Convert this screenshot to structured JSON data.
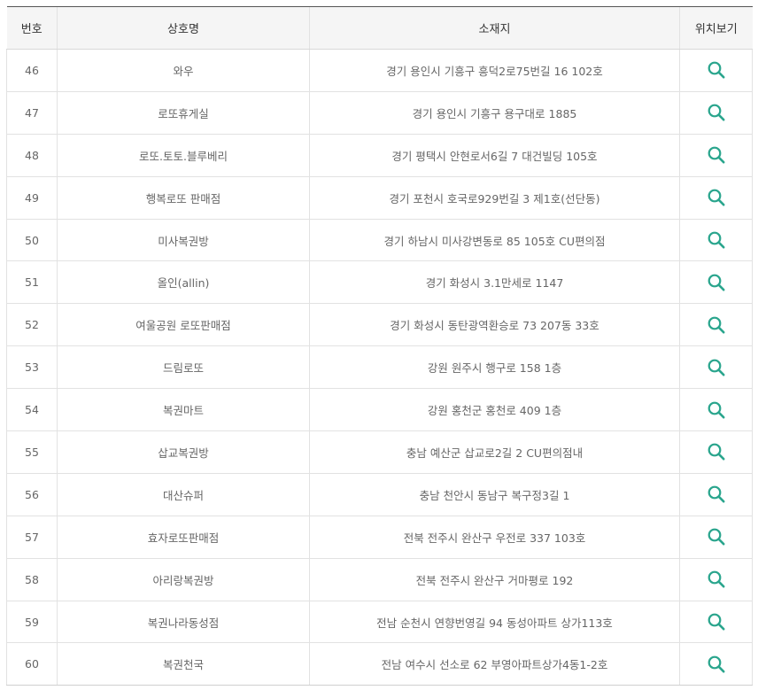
{
  "table": {
    "headers": [
      "번호",
      "상호명",
      "소재지",
      "위치보기"
    ],
    "rows": [
      {
        "no": "46",
        "name": "와우",
        "address": "경기 용인시 기흥구 흥덕2로75번길 16 102호"
      },
      {
        "no": "47",
        "name": "로또휴게실",
        "address": "경기 용인시 기흥구 용구대로 1885"
      },
      {
        "no": "48",
        "name": "로또.토토.블루베리",
        "address": "경기 평택시 안현로서6길 7 대건빌딩 105호"
      },
      {
        "no": "49",
        "name": "행복로또 판매점",
        "address": "경기 포천시 호국로929번길 3 제1호(선단동)"
      },
      {
        "no": "50",
        "name": "미사복권방",
        "address": "경기 하남시 미사강변동로 85 105호 CU편의점"
      },
      {
        "no": "51",
        "name": "올인(allin)",
        "address": "경기 화성시 3.1만세로 1147"
      },
      {
        "no": "52",
        "name": "여울공원 로또판매점",
        "address": "경기 화성시 동탄광역환승로 73 207동 33호"
      },
      {
        "no": "53",
        "name": "드림로또",
        "address": "강원 원주시 행구로 158 1층"
      },
      {
        "no": "54",
        "name": "복권마트",
        "address": "강원 홍천군 홍천로 409 1층"
      },
      {
        "no": "55",
        "name": "삽교복권방",
        "address": "충남 예산군 삽교로2길 2 CU편의점내"
      },
      {
        "no": "56",
        "name": "대산슈퍼",
        "address": "충남 천안시 동남구 복구정3길 1"
      },
      {
        "no": "57",
        "name": "효자로또판매점",
        "address": "전북 전주시 완산구 우전로 337 103호"
      },
      {
        "no": "58",
        "name": "아리랑복권방",
        "address": "전북 전주시 완산구 거마평로 192"
      },
      {
        "no": "59",
        "name": "복권나라동성점",
        "address": "전남 순천시 연향번영길 94 동성아파트 상가113호"
      },
      {
        "no": "60",
        "name": "복권천국",
        "address": "전남 여수시 선소로 62 부영아파트상가4동1-2호"
      }
    ]
  },
  "icons": {
    "location": "search-icon"
  },
  "colors": {
    "accent": "#2aa58d",
    "header_bg": "#f5f5f5",
    "text": "#666666"
  }
}
